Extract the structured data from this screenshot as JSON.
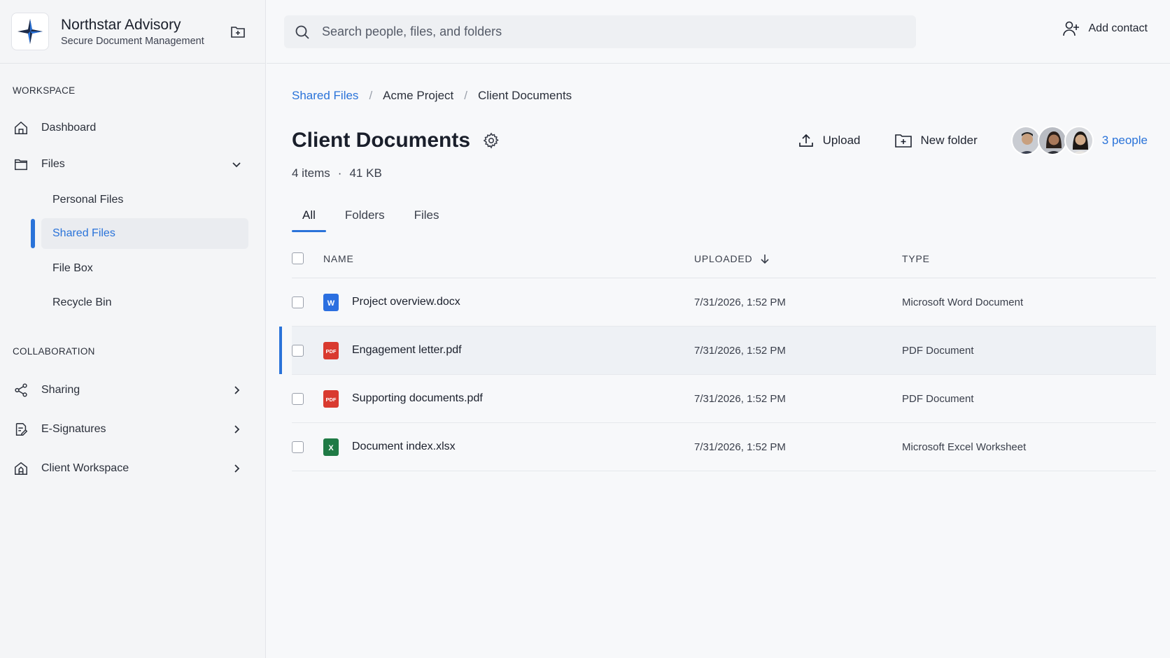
{
  "brand": {
    "name": "Northstar Advisory",
    "subtitle": "Secure Document Management"
  },
  "sidebar": {
    "workspace_label": "WORKSPACE",
    "dashboard": "Dashboard",
    "files": "Files",
    "files_children": [
      "Personal Files",
      "Shared Files",
      "File Box",
      "Recycle Bin"
    ],
    "active_child": "Shared Files",
    "collaboration_label": "COLLABORATION",
    "sharing": "Sharing",
    "esignatures": "E-Signatures",
    "client_workspace": "Client Workspace"
  },
  "search": {
    "placeholder": "Search people, files, and folders"
  },
  "topbar": {
    "add_contact": "Add contact"
  },
  "breadcrumb": [
    "Shared Files",
    "Acme Project",
    "Client Documents"
  ],
  "page": {
    "title": "Client Documents",
    "item_count": "4 items",
    "size": "41 KB",
    "upload": "Upload",
    "new_folder": "New folder",
    "people": "3 people"
  },
  "tabs": [
    "All",
    "Folders",
    "Files"
  ],
  "table": {
    "headers": {
      "name": "NAME",
      "uploaded": "UPLOADED",
      "type": "TYPE"
    },
    "rows": [
      {
        "name": "Project overview.docx",
        "uploaded": "7/31/2026, 1:52 PM",
        "type": "Microsoft Word Document",
        "icon": "word-file-icon",
        "icon_text": "W",
        "icon_color": "#2b6fe0"
      },
      {
        "name": "Engagement letter.pdf",
        "uploaded": "7/31/2026, 1:52 PM",
        "type": "PDF Document",
        "icon": "pdf-file-icon",
        "icon_text": "PDF",
        "icon_color": "#d93a2f"
      },
      {
        "name": "Supporting documents.pdf",
        "uploaded": "7/31/2026, 1:52 PM",
        "type": "PDF Document",
        "icon": "pdf-file-icon",
        "icon_text": "PDF",
        "icon_color": "#d93a2f"
      },
      {
        "name": "Document index.xlsx",
        "uploaded": "7/31/2026, 1:52 PM",
        "type": "Microsoft Excel Worksheet",
        "icon": "excel-file-icon",
        "icon_text": "X",
        "icon_color": "#1f7a45"
      }
    ]
  },
  "colors": {
    "accent": "#2a73d9",
    "selected_row": "#eef1f5"
  }
}
